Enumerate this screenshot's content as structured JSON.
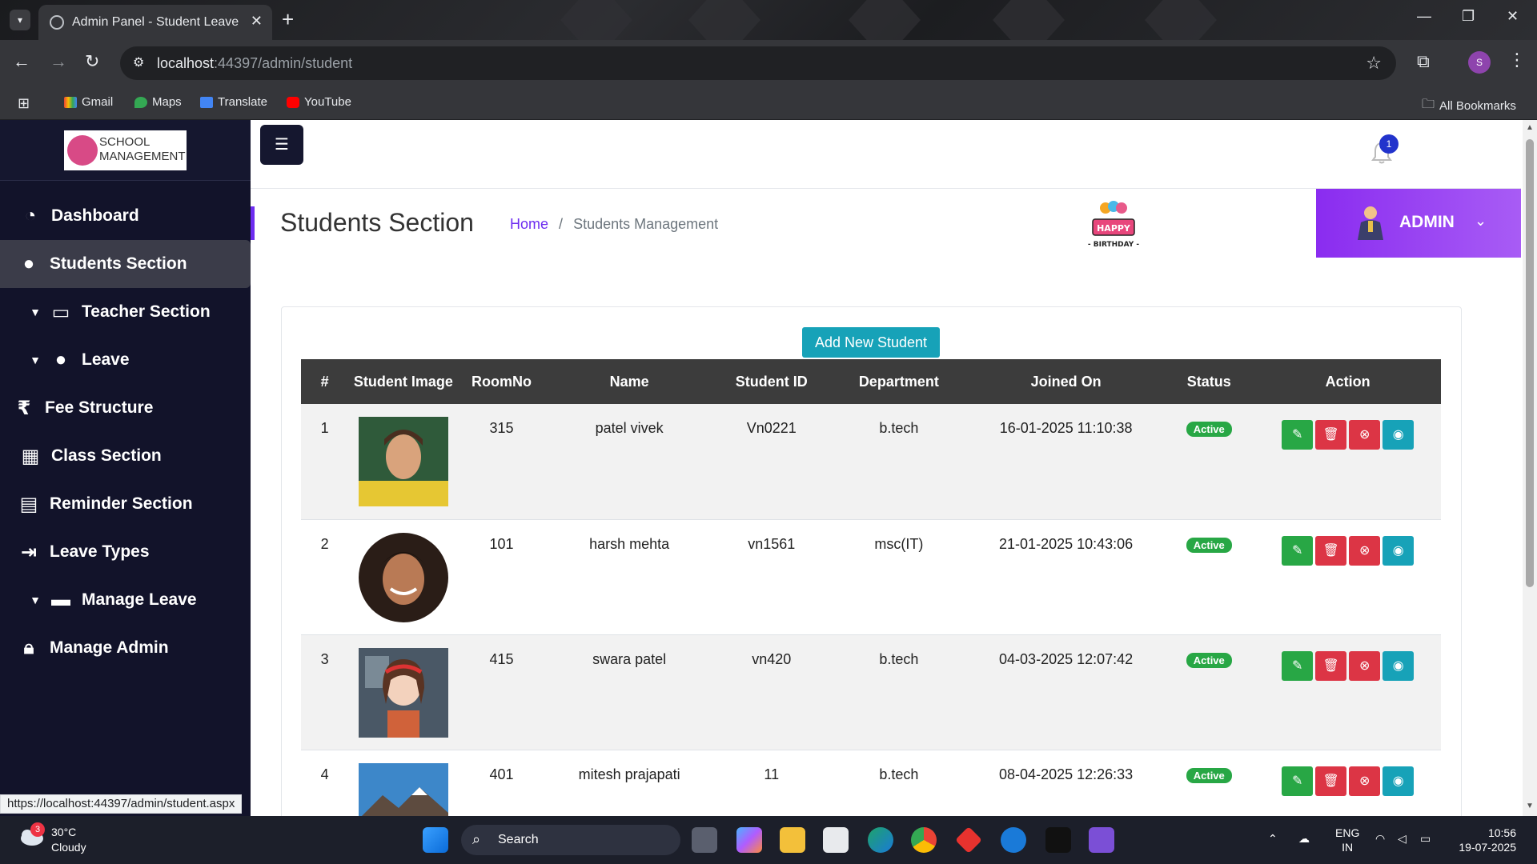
{
  "browser": {
    "tab_title": "Admin Panel - Student Leave",
    "url_host": "localhost",
    "url_rest": ":44397/admin/student",
    "bookmarks": [
      "Gmail",
      "Maps",
      "Translate",
      "YouTube"
    ],
    "all_bookmarks": "All Bookmarks",
    "profile_initial": "S",
    "status_url": "https://localhost:44397/admin/student.aspx"
  },
  "sidebar": {
    "logo_line1": "SCHOOL",
    "logo_line2": "MANAGEMENT",
    "items": [
      {
        "label": "Dashboard",
        "icon": "dashboard-icon"
      },
      {
        "label": "Students Section",
        "icon": "user-icon",
        "active": true
      },
      {
        "label": "Teacher Section",
        "icon": "teacher-icon",
        "caret": true
      },
      {
        "label": "Leave",
        "icon": "person-icon",
        "caret": true
      },
      {
        "label": "Fee Structure",
        "icon": "rupee-icon"
      },
      {
        "label": "Class Section",
        "icon": "table-icon"
      },
      {
        "label": "Reminder Section",
        "icon": "calendar-icon"
      },
      {
        "label": "Leave Types",
        "icon": "sign-out-icon"
      },
      {
        "label": "Manage Leave",
        "icon": "briefcase-icon",
        "caret": true
      },
      {
        "label": "Manage Admin",
        "icon": "lock-icon"
      }
    ]
  },
  "topbar": {
    "notification_count": "1"
  },
  "header": {
    "title": "Students Section",
    "breadcrumb_home": "Home",
    "breadcrumb_sep": "/",
    "breadcrumb_current": "Students Management",
    "birthday_text": "HAPPY",
    "birthday_text2": "- BIRTHDAY -",
    "admin_label": "ADMIN"
  },
  "students": {
    "add_button": "Add New Student",
    "columns": [
      "#",
      "Student Image",
      "RoomNo",
      "Name",
      "Student ID",
      "Department",
      "Joined On",
      "Status",
      "Action"
    ],
    "rows": [
      {
        "num": "1",
        "room": "315",
        "name": "patel vivek",
        "id": "Vn0221",
        "dept": "b.tech",
        "joined": "16-01-2025 11:10:38",
        "status": "Active"
      },
      {
        "num": "2",
        "room": "101",
        "name": "harsh mehta",
        "id": "vn1561",
        "dept": "msc(IT)",
        "joined": "21-01-2025 10:43:06",
        "status": "Active"
      },
      {
        "num": "3",
        "room": "415",
        "name": "swara patel",
        "id": "vn420",
        "dept": "b.tech",
        "joined": "04-03-2025 12:07:42",
        "status": "Active"
      },
      {
        "num": "4",
        "room": "401",
        "name": "mitesh prajapati",
        "id": "11",
        "dept": "b.tech",
        "joined": "08-04-2025 12:26:33",
        "status": "Active"
      }
    ]
  },
  "taskbar": {
    "weather_temp": "30°C",
    "weather_cond": "Cloudy",
    "weather_badge": "3",
    "search_label": "Search",
    "lang1": "ENG",
    "lang2": "IN",
    "time": "10:56",
    "date": "19-07-2025"
  },
  "colors": {
    "sidebar_bg": "#12132a",
    "accent_purple": "#8a2cf0",
    "teal": "#17a2b8",
    "success": "#28a745",
    "danger": "#dc3545"
  }
}
